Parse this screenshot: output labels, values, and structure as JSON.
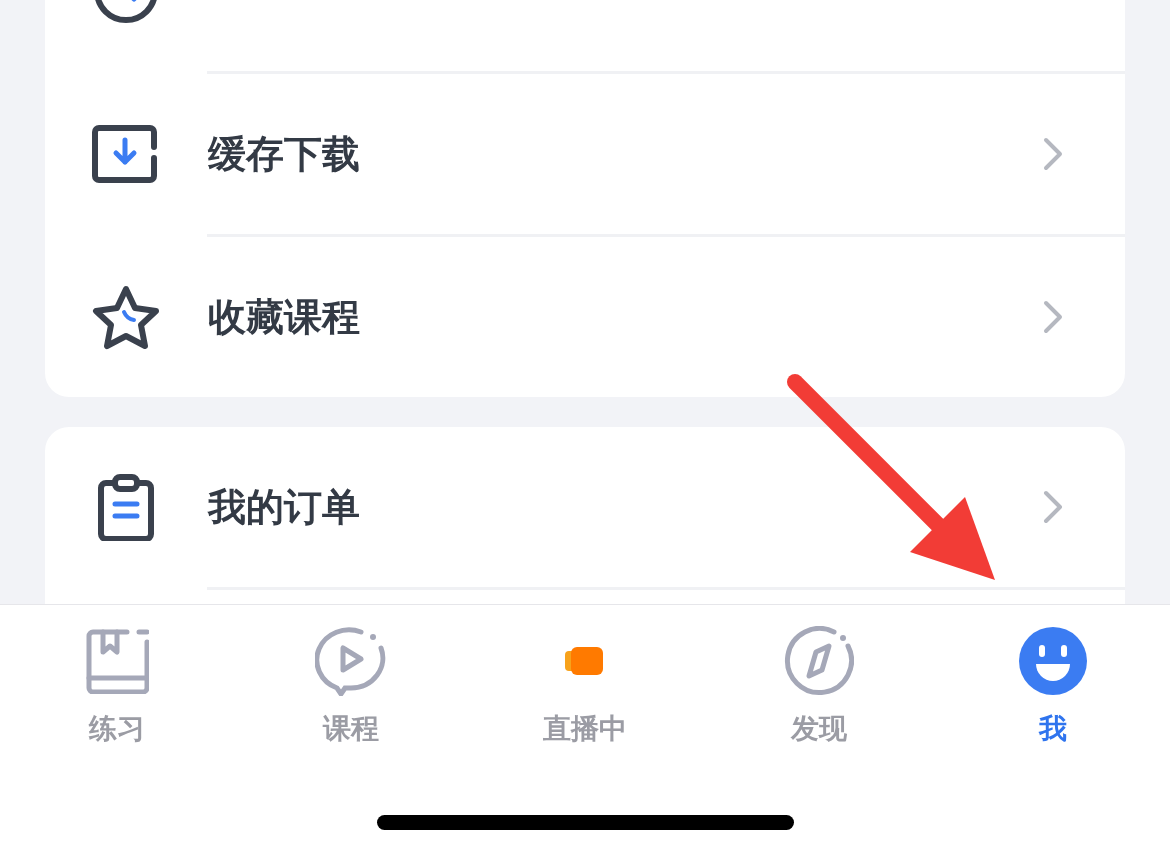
{
  "menu_groups": [
    {
      "items": [
        {
          "kind": "history"
        },
        {
          "kind": "download",
          "label": "缓存下载"
        },
        {
          "kind": "favorite",
          "label": "收藏课程"
        }
      ]
    },
    {
      "items": [
        {
          "kind": "orders",
          "label": "我的订单"
        }
      ]
    }
  ],
  "tab_bar": [
    {
      "kind": "practice",
      "label": "练习",
      "selected": false
    },
    {
      "kind": "courses",
      "label": "课程",
      "selected": false
    },
    {
      "kind": "live",
      "label": "直播中",
      "selected": false
    },
    {
      "kind": "discover",
      "label": "发现",
      "selected": false
    },
    {
      "kind": "me",
      "label": "我",
      "selected": true
    }
  ]
}
